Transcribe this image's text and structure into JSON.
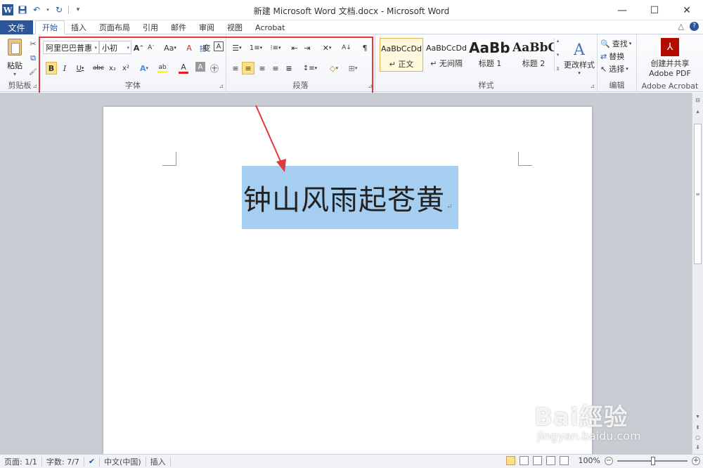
{
  "window": {
    "title": "新建 Microsoft Word 文档.docx - Microsoft Word",
    "app_logo": "W",
    "qat": {
      "save": "save-icon",
      "undo": "undo-icon",
      "redo": "redo-icon",
      "customize": "▾"
    },
    "minimize": "—",
    "maximize": "☐",
    "close": "✕"
  },
  "tabs": {
    "file": "文件",
    "items": [
      "开始",
      "插入",
      "页面布局",
      "引用",
      "邮件",
      "审阅",
      "视图",
      "Acrobat"
    ],
    "active_index": 0,
    "help": "?",
    "collapse": "△"
  },
  "ribbon": {
    "clipboard": {
      "label": "剪贴板",
      "paste": "粘贴",
      "cut": "✂",
      "copy": "⧉",
      "format_painter": "🖌"
    },
    "font": {
      "label": "字体",
      "font_name": "阿里巴巴普惠",
      "font_size": "小初",
      "grow": "A",
      "shrink": "A",
      "change_case": "Aa",
      "clear_format": "A",
      "phonetic": "拼",
      "char_border": "变",
      "enclose": "A",
      "bold": "B",
      "italic": "I",
      "underline": "U",
      "strike": "abc",
      "subscript": "x₂",
      "superscript": "x²",
      "text_effects": "A",
      "highlight": "ab",
      "font_color": "A",
      "char_shading": "A",
      "enclosed_char": "㊉"
    },
    "paragraph": {
      "label": "段落",
      "bullets": "☰",
      "numbering": "1≡",
      "multilevel": "⁝≡",
      "decrease_indent": "⇤",
      "increase_indent": "⇥",
      "chinese_layout": "✕",
      "sort": "A↓",
      "show_marks": "¶",
      "align_left": "≡",
      "center": "≡",
      "align_right": "≡",
      "justify": "≡",
      "distribute": "≡",
      "line_spacing": "↕≡",
      "shading": "◇",
      "borders": "⊞"
    },
    "styles": {
      "label": "样式",
      "items": [
        {
          "sample": "AaBbCcDd",
          "name": "↵ 正文"
        },
        {
          "sample": "AaBbCcDd",
          "name": "↵ 无间隔"
        },
        {
          "sample": "AaBb",
          "name": "标题 1"
        },
        {
          "sample": "AaBbC",
          "name": "标题 2"
        }
      ],
      "change_styles": "更改样式"
    },
    "editing": {
      "label": "编辑",
      "find": "查找",
      "replace": "替换",
      "select": "选择"
    },
    "acrobat": {
      "label": "Adobe Acrobat",
      "create_line1": "创建并共享",
      "create_line2": "Adobe PDF"
    }
  },
  "document": {
    "selected_text": "钟山风雨起苍黄",
    "paragraph_mark": "↵"
  },
  "watermark": {
    "main": "Bai經验",
    "sub": "jingyan.baidu.com"
  },
  "statusbar": {
    "page": "页面: 1/1",
    "words": "字数: 7/7",
    "language": "中文(中国)",
    "mode": "插入",
    "zoom": "100%",
    "zoom_out": "−",
    "zoom_in": "+"
  },
  "colors": {
    "file_tab": "#2b579a",
    "selection": "#a6cef0",
    "annotation_red": "#e03a3a",
    "font_color_bar": "#e02020",
    "highlight_bar": "#ffff00"
  }
}
